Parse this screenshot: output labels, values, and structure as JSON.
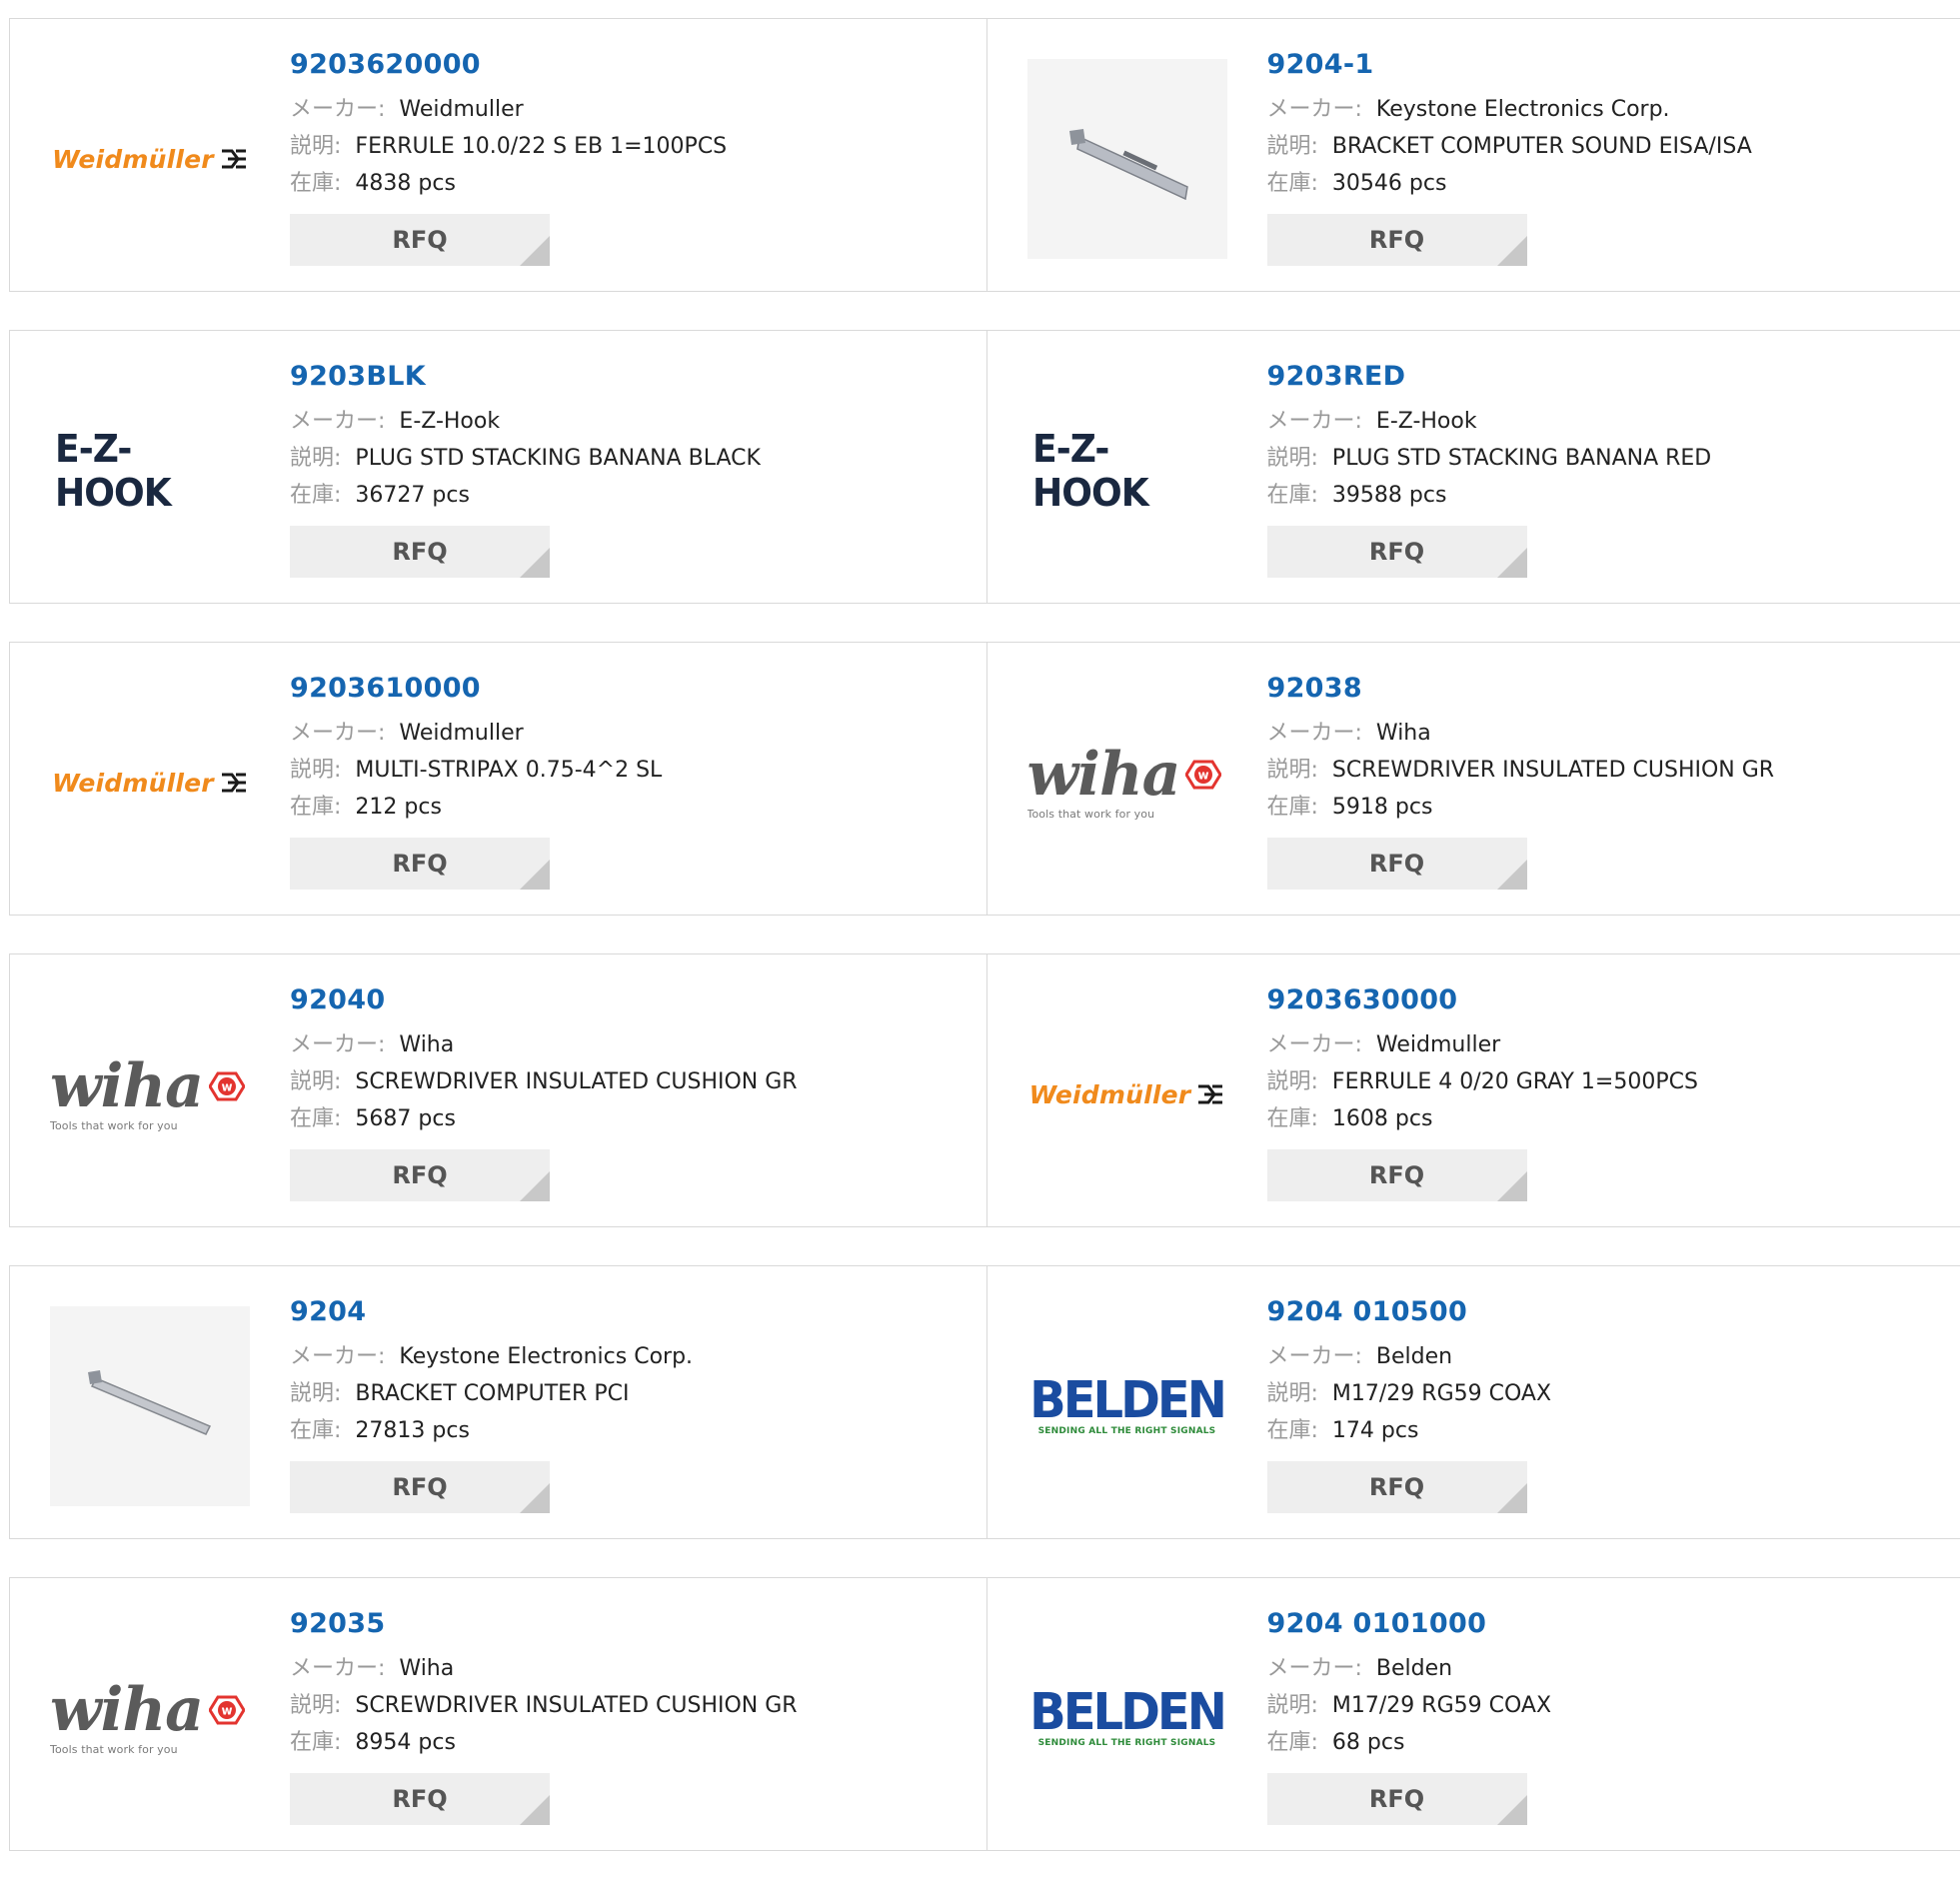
{
  "labels": {
    "manufacturer": "メーカー:",
    "description": "説明:",
    "stock": "在庫:",
    "rfq": "RFQ"
  },
  "products": [
    {
      "pn": "9203620000",
      "manufacturer": "Weidmuller",
      "description": "FERRULE 10.0/22 S EB 1=100PCS",
      "stock": "4838 pcs",
      "logo": "weidmuller",
      "logo_text": "Weidmüller"
    },
    {
      "pn": "9204-1",
      "manufacturer": "Keystone Electronics Corp.",
      "description": "BRACKET COMPUTER SOUND EISA/ISA",
      "stock": "30546 pcs",
      "logo": "photo-bracket-short"
    },
    {
      "pn": "9203BLK",
      "manufacturer": "E-Z-Hook",
      "description": "PLUG STD STACKING BANANA BLACK",
      "stock": "36727 pcs",
      "logo": "ezhook",
      "logo_text": "E-Z-HOOK"
    },
    {
      "pn": "9203RED",
      "manufacturer": "E-Z-Hook",
      "description": "PLUG STD STACKING BANANA RED",
      "stock": "39588 pcs",
      "logo": "ezhook",
      "logo_text": "E-Z-HOOK"
    },
    {
      "pn": "9203610000",
      "manufacturer": "Weidmuller",
      "description": "MULTI-STRIPAX 0.75-4^2 SL",
      "stock": "212 pcs",
      "logo": "weidmuller",
      "logo_text": "Weidmüller"
    },
    {
      "pn": "92038",
      "manufacturer": "Wiha",
      "description": "SCREWDRIVER INSULATED CUSHION GR",
      "stock": "5918 pcs",
      "logo": "wiha",
      "logo_text": "wiha",
      "logo_tagline": "Tools that work for you"
    },
    {
      "pn": "92040",
      "manufacturer": "Wiha",
      "description": "SCREWDRIVER INSULATED CUSHION GR",
      "stock": "5687 pcs",
      "logo": "wiha",
      "logo_text": "wiha",
      "logo_tagline": "Tools that work for you"
    },
    {
      "pn": "9203630000",
      "manufacturer": "Weidmuller",
      "description": "FERRULE 4 0/20 GRAY 1=500PCS",
      "stock": "1608 pcs",
      "logo": "weidmuller",
      "logo_text": "Weidmüller"
    },
    {
      "pn": "9204",
      "manufacturer": "Keystone Electronics Corp.",
      "description": "BRACKET COMPUTER PCI",
      "stock": "27813 pcs",
      "logo": "photo-bracket-long"
    },
    {
      "pn": "9204 010500",
      "manufacturer": "Belden",
      "description": "M17/29 RG59 COAX",
      "stock": "174 pcs",
      "logo": "belden",
      "logo_text": "BELDEN",
      "logo_tagline": "SENDING ALL THE RIGHT SIGNALS"
    },
    {
      "pn": "92035",
      "manufacturer": "Wiha",
      "description": "SCREWDRIVER INSULATED CUSHION GR",
      "stock": "8954 pcs",
      "logo": "wiha",
      "logo_text": "wiha",
      "logo_tagline": "Tools that work for you"
    },
    {
      "pn": "9204 0101000",
      "manufacturer": "Belden",
      "description": "M17/29 RG59 COAX",
      "stock": "68 pcs",
      "logo": "belden",
      "logo_text": "BELDEN",
      "logo_tagline": "SENDING ALL THE RIGHT SIGNALS"
    }
  ],
  "colors": {
    "part_number": "#1565b0",
    "weidmuller_orange": "#f08a1c",
    "wiha_red": "#e3342f",
    "belden_blue": "#1a4ca0",
    "belden_green": "#2e8b3a",
    "rfq_bg": "#eeeeee"
  }
}
